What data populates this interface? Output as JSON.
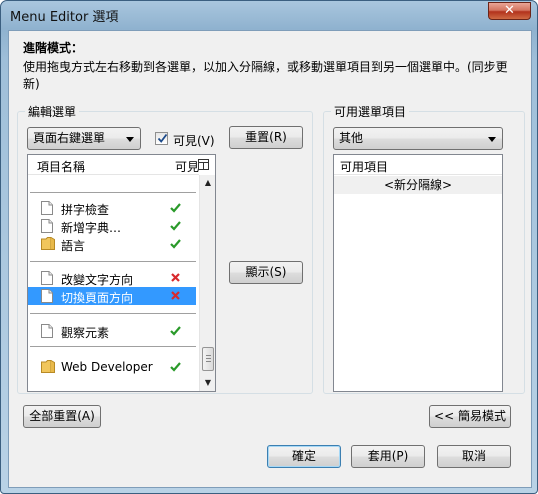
{
  "window": {
    "title": "Menu Editor 選項",
    "close_glyph": "✕"
  },
  "advanced": {
    "heading": "進階模式：",
    "description": "使用拖曳方式左右移動到各選單，以加入分隔線，或移動選單項目到另一個選單中。(同步更新)"
  },
  "edit_menu": {
    "group_label": "編輯選單",
    "menu_select": "頁面右鍵選單",
    "visible_label": "可見(V)",
    "visible_checked": true,
    "reset_button": "重置(R)",
    "show_button": "顯示(S)",
    "columns": {
      "name": "項目名稱",
      "visible": "可見"
    },
    "items": [
      {
        "label": "拼字檢查",
        "icon": "page-icon",
        "visible": true
      },
      {
        "label": "新增字典…",
        "icon": "page-icon",
        "visible": true
      },
      {
        "label": "語言",
        "icon": "folder-icon",
        "visible": true
      },
      {
        "label": "改變文字方向",
        "icon": "page-icon",
        "visible": false
      },
      {
        "label": "切換頁面方向",
        "icon": "page-icon",
        "visible": false,
        "selected": true
      },
      {
        "label": "觀察元素",
        "icon": "page-icon",
        "visible": true
      },
      {
        "label": "Web Developer",
        "icon": "folder-icon",
        "visible": true
      }
    ]
  },
  "available": {
    "group_label": "可用選單項目",
    "menu_select": "其他",
    "column": "可用項目",
    "items": [
      "<新分隔線>"
    ]
  },
  "buttons": {
    "reset_all": "全部重置(A)",
    "simple_mode": "<< 簡易模式",
    "ok": "確定",
    "apply": "套用(P)",
    "cancel": "取消"
  },
  "colors": {
    "visible_check": "#2a9a2a",
    "hidden_cross": "#d8292d",
    "selection": "#3399ff"
  }
}
